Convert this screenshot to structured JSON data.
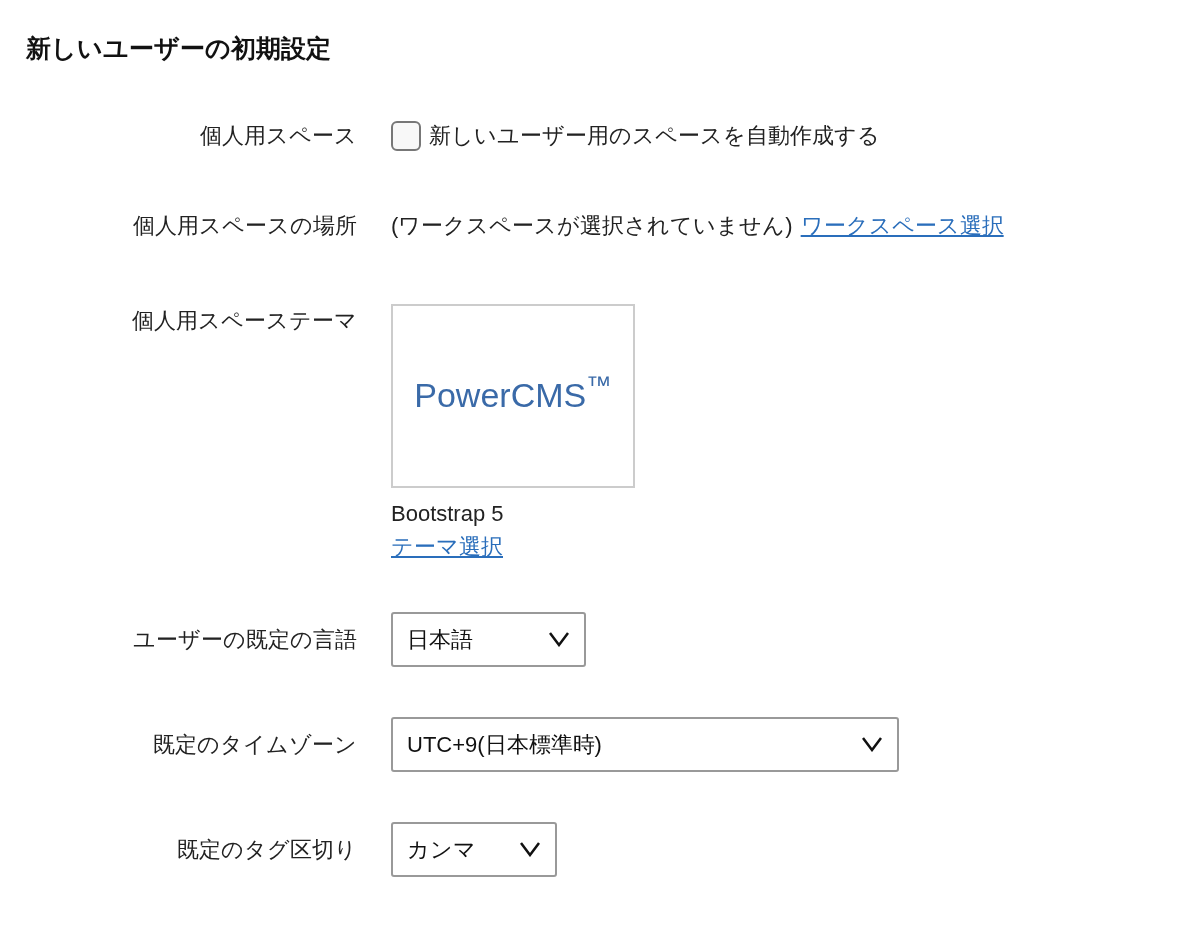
{
  "title": "新しいユーザーの初期設定",
  "rows": [
    {
      "kind": "checkbox",
      "label": "個人用スペース",
      "checked": false,
      "text": "新しいユーザー用のスペースを自動作成する"
    },
    {
      "kind": "link",
      "label": "個人用スペースの場所",
      "text": "(ワークスペースが選択されていません)",
      "link": "ワークスペース選択"
    },
    {
      "kind": "theme",
      "label": "個人用スペーステーマ",
      "logo": "PowerCMS$^{™}$",
      "name": "Bootstrap 5",
      "link": "テーマ選択"
    },
    {
      "kind": "select",
      "label": "ユーザーの既定の言語",
      "value": "日本語"
    },
    {
      "kind": "select",
      "label": "既定のタイムゾーン",
      "value": "UTC+9(日本標準時)"
    },
    {
      "kind": "select",
      "label": "既定のタグ区切り",
      "value": "カンマ"
    }
  ]
}
